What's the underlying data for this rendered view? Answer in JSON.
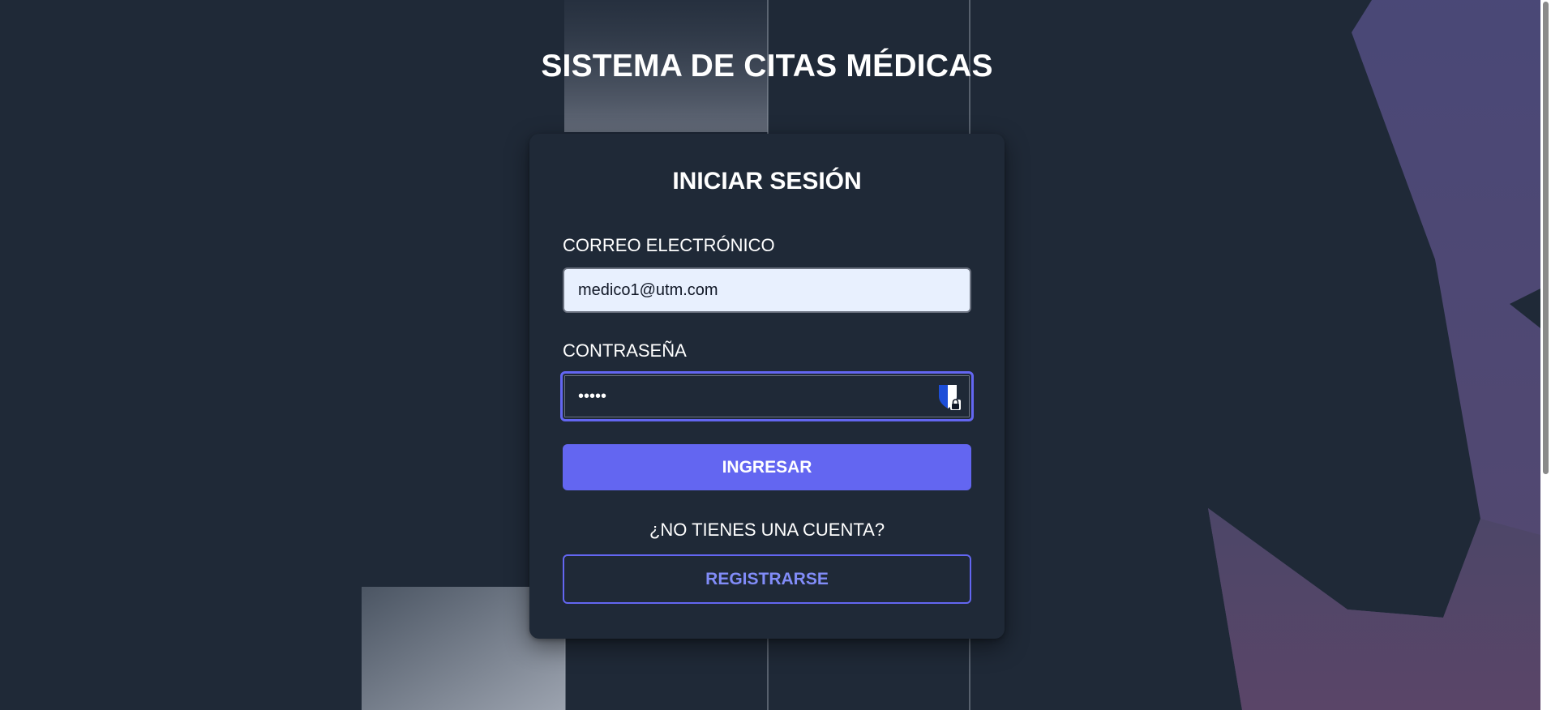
{
  "page": {
    "title": "SISTEMA DE CITAS MÉDICAS"
  },
  "login": {
    "heading": "INICIAR SESIÓN",
    "email_label": "CORREO ELECTRÓNICO",
    "email_value": "medico1@utm.com",
    "password_label": "CONTRASEÑA",
    "password_masked": "•••••",
    "password_manager_icon": "password-manager-icon",
    "submit_label": "INGRESAR",
    "no_account_text": "¿NO TIENES UNA CUENTA?",
    "register_label": "REGISTRARSE"
  },
  "colors": {
    "background": "#1f2937",
    "accent": "#6366f1",
    "accent_text": "#818cf8",
    "autofill_bg": "#e8f0fe"
  }
}
